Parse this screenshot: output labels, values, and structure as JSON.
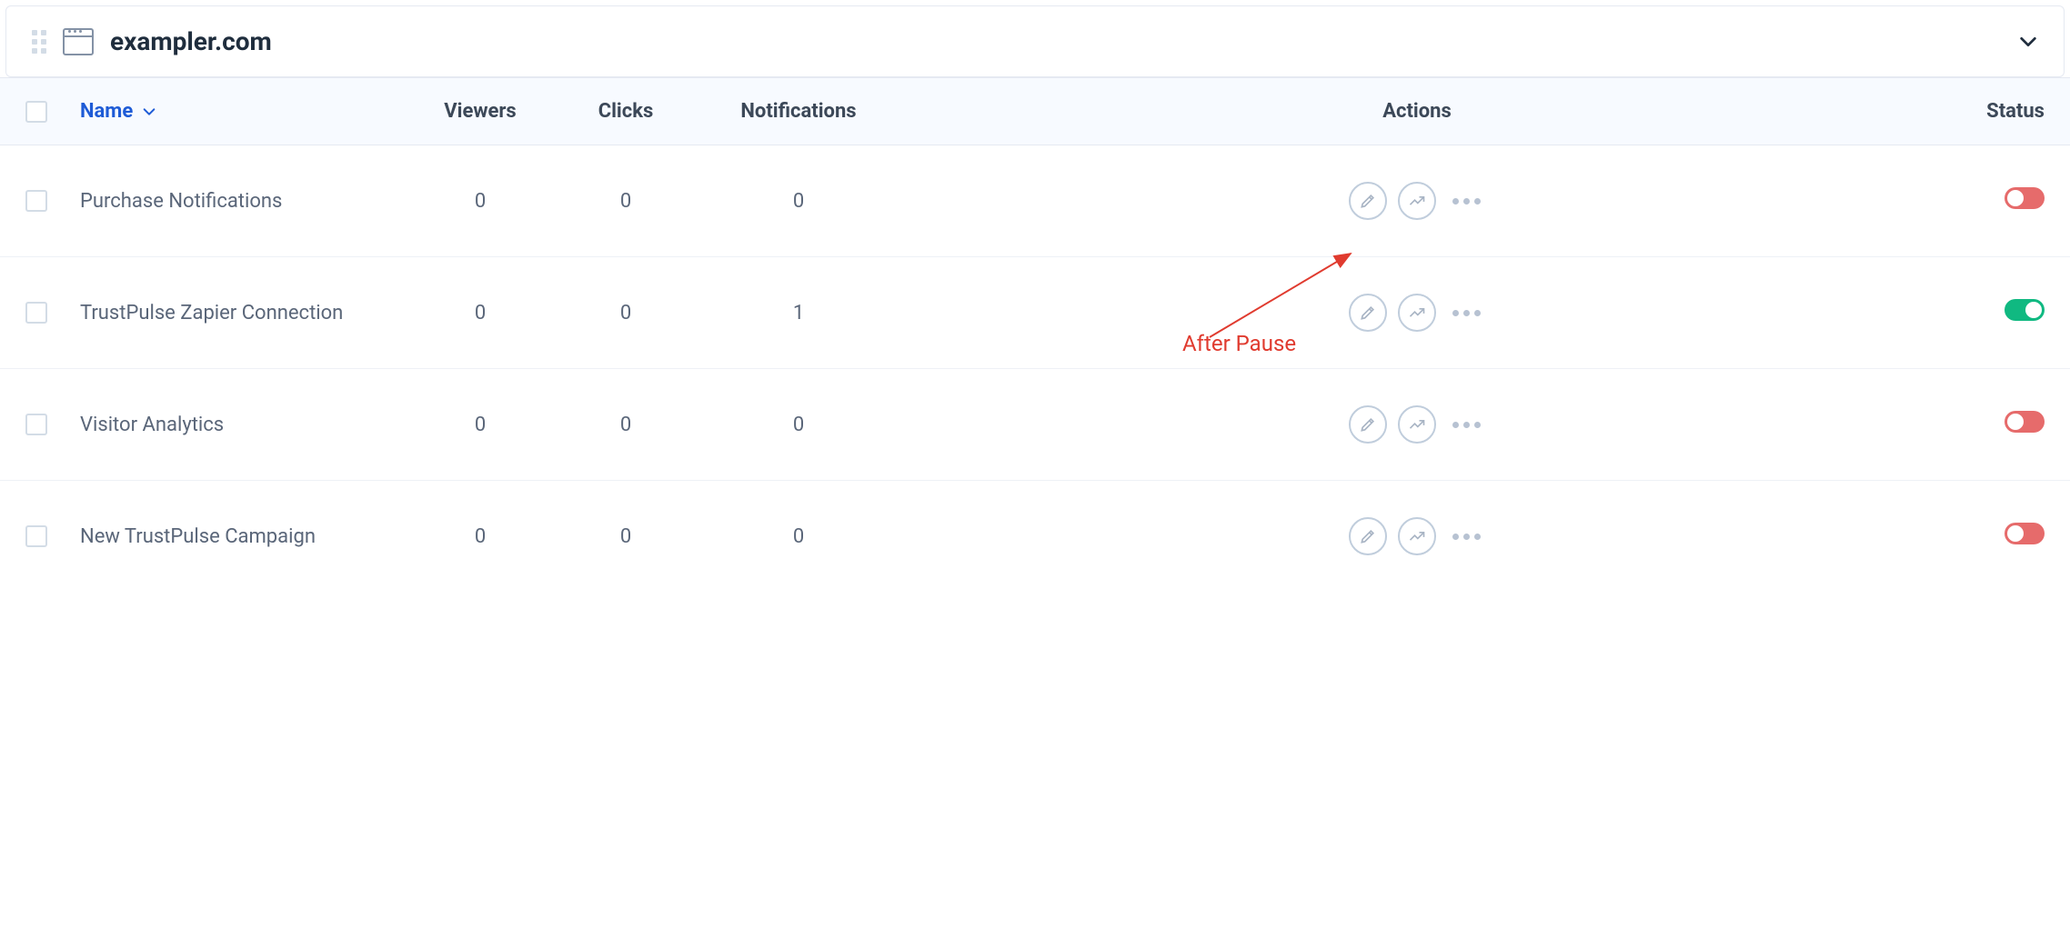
{
  "header": {
    "site": "exampler.com"
  },
  "columns": {
    "name": "Name",
    "viewers": "Viewers",
    "clicks": "Clicks",
    "notifications": "Notifications",
    "actions": "Actions",
    "status": "Status"
  },
  "rows": [
    {
      "name": "Purchase Notifications",
      "viewers": "0",
      "clicks": "0",
      "notifications": "0",
      "status": "off"
    },
    {
      "name": "TrustPulse Zapier Connection",
      "viewers": "0",
      "clicks": "0",
      "notifications": "1",
      "status": "on"
    },
    {
      "name": "Visitor Analytics",
      "viewers": "0",
      "clicks": "0",
      "notifications": "0",
      "status": "off"
    },
    {
      "name": "New TrustPulse Campaign",
      "viewers": "0",
      "clicks": "0",
      "notifications": "0",
      "status": "off"
    }
  ],
  "annotation": {
    "label": "After Pause"
  }
}
